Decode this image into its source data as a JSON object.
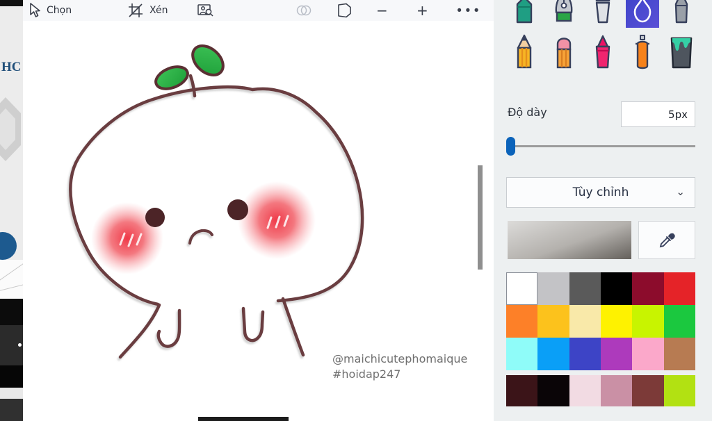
{
  "background_window": {
    "heading_fragment": "HC"
  },
  "toolbar": {
    "select_label": "Chọn",
    "crop_label": "Xén",
    "zoom_out_glyph": "−",
    "zoom_in_glyph": "+",
    "more_glyph": "∙∙∙"
  },
  "tools": {
    "row1": [
      "marker",
      "calligraphy-pen",
      "oil-brush",
      "watercolor",
      "pixel-pen"
    ],
    "row2": [
      "pencil",
      "eraser",
      "crayon",
      "spray-can",
      "fill-bucket"
    ],
    "selected": "watercolor",
    "selected_bg": "#4348ce"
  },
  "thickness": {
    "label": "Độ dày",
    "value": "5px"
  },
  "customize": {
    "label": "Tùy chỉnh"
  },
  "color_preview": {
    "top": "#dcdbd9",
    "bottom": "#64605b"
  },
  "palette": {
    "rows": [
      [
        "#ffffff",
        "#c3c3c6",
        "#5a5a5a",
        "#000000",
        "#8c0c2c",
        "#e52328"
      ],
      [
        "#fd8028",
        "#fcc21c",
        "#f9e9a9",
        "#fef200",
        "#c8f400",
        "#1bc83f"
      ],
      [
        "#8ffcf9",
        "#0a9ff7",
        "#3d44c6",
        "#ad3abc",
        "#fba8ca",
        "#b77b52"
      ]
    ],
    "custom": [
      "#3b1418",
      "#0a0507",
      "#f2dbe3",
      "#ca90a5",
      "#7c3a38",
      "#b2e112"
    ],
    "selected_index": 0
  },
  "canvas": {
    "signature_line1": "@maichicutephomaique",
    "signature_line2": "#hoidap247",
    "drawing": {
      "subject": "sprout-mochi-character",
      "outline_color": "#6b3d41",
      "eye_color": "#4c2427",
      "blush_color": "#ee2e3e",
      "leaf_color": "#27ab3f"
    }
  }
}
